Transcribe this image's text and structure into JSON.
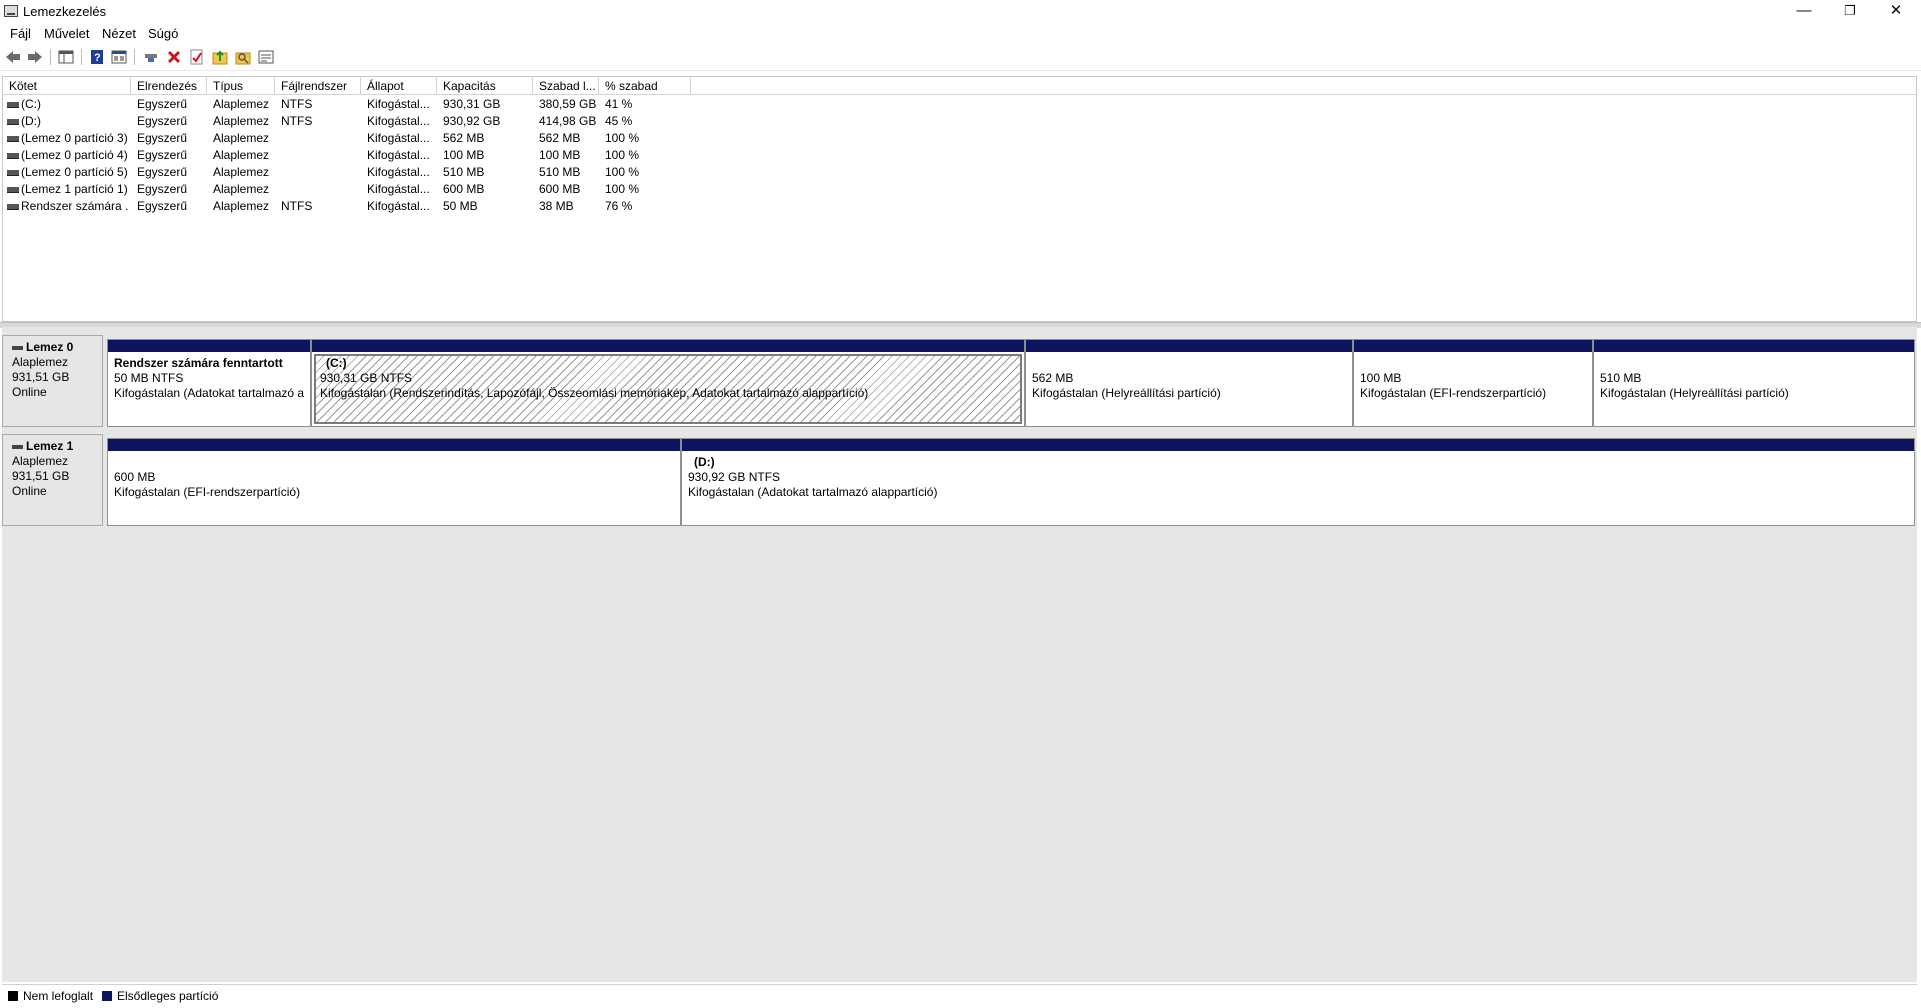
{
  "window": {
    "title": "Lemezkezelés",
    "minimize": "—",
    "restore": "❐",
    "close": "✕"
  },
  "menu": [
    "Fájl",
    "Művelet",
    "Nézet",
    "Súgó"
  ],
  "columns": [
    "Kötet",
    "Elrendezés",
    "Típus",
    "Fájlrendszer",
    "Állapot",
    "Kapacitás",
    "Szabad l...",
    "% szabad"
  ],
  "volumes": [
    {
      "name": "(C:)",
      "layout": "Egyszerű",
      "type": "Alaplemez",
      "fs": "NTFS",
      "status": "Kifogástal...",
      "capacity": "930,31 GB",
      "free": "380,59 GB",
      "pct": "41 %"
    },
    {
      "name": "(D:)",
      "layout": "Egyszerű",
      "type": "Alaplemez",
      "fs": "NTFS",
      "status": "Kifogástal...",
      "capacity": "930,92 GB",
      "free": "414,98 GB",
      "pct": "45 %"
    },
    {
      "name": "(Lemez 0 partíció 3)",
      "layout": "Egyszerű",
      "type": "Alaplemez",
      "fs": "",
      "status": "Kifogástal...",
      "capacity": "562 MB",
      "free": "562 MB",
      "pct": "100 %"
    },
    {
      "name": "(Lemez 0 partíció 4)",
      "layout": "Egyszerű",
      "type": "Alaplemez",
      "fs": "",
      "status": "Kifogástal...",
      "capacity": "100 MB",
      "free": "100 MB",
      "pct": "100 %"
    },
    {
      "name": "(Lemez 0 partíció 5)",
      "layout": "Egyszerű",
      "type": "Alaplemez",
      "fs": "",
      "status": "Kifogástal...",
      "capacity": "510 MB",
      "free": "510 MB",
      "pct": "100 %"
    },
    {
      "name": "(Lemez 1 partíció 1)",
      "layout": "Egyszerű",
      "type": "Alaplemez",
      "fs": "",
      "status": "Kifogástal...",
      "capacity": "600 MB",
      "free": "600 MB",
      "pct": "100 %"
    },
    {
      "name": "Rendszer számára ...",
      "layout": "Egyszerű",
      "type": "Alaplemez",
      "fs": "NTFS",
      "status": "Kifogástal...",
      "capacity": "50 MB",
      "free": "38 MB",
      "pct": "76 %"
    }
  ],
  "disks": [
    {
      "name": "Lemez 0",
      "type": "Alaplemez",
      "size": "931,51 GB",
      "status": "Online",
      "partitions": [
        {
          "title": "Rendszer számára fenntartott",
          "size": "50 MB NTFS",
          "status": "Kifogástalan (Adatokat tartalmazó a"
        },
        {
          "title": "(C:)",
          "size": "930,31 GB NTFS",
          "status": "Kifogástalan (Rendszerindítás, Lapozófájl, Összeomlási memóriakép, Adatokat tartalmazó alappartíció)"
        },
        {
          "title": "",
          "size": "562 MB",
          "status": "Kifogástalan (Helyreállítási partíció)"
        },
        {
          "title": "",
          "size": "100 MB",
          "status": "Kifogástalan (EFI-rendszerpartíció)"
        },
        {
          "title": "",
          "size": "510 MB",
          "status": "Kifogástalan (Helyreállítási partíció)"
        }
      ]
    },
    {
      "name": "Lemez 1",
      "type": "Alaplemez",
      "size": "931,51 GB",
      "status": "Online",
      "partitions": [
        {
          "title": "",
          "size": "600 MB",
          "status": "Kifogástalan (EFI-rendszerpartíció)"
        },
        {
          "title": "(D:)",
          "size": "930,92 GB NTFS",
          "status": "Kifogástalan (Adatokat tartalmazó alappartíció)"
        }
      ]
    }
  ],
  "legend": [
    {
      "label": "Nem lefoglalt",
      "color": "#000000"
    },
    {
      "label": "Elsődleges partíció",
      "color": "#0f1460"
    }
  ],
  "colors": {
    "primary_partition": "#0f1460",
    "unallocated": "#000000"
  },
  "toolbar_icons": [
    "back-icon",
    "forward-icon",
    "console-tree-icon",
    "help-icon",
    "properties-icon",
    "connect-icon",
    "delete-icon",
    "check-icon",
    "folder-up-icon",
    "folder-search-icon",
    "view-icon"
  ]
}
